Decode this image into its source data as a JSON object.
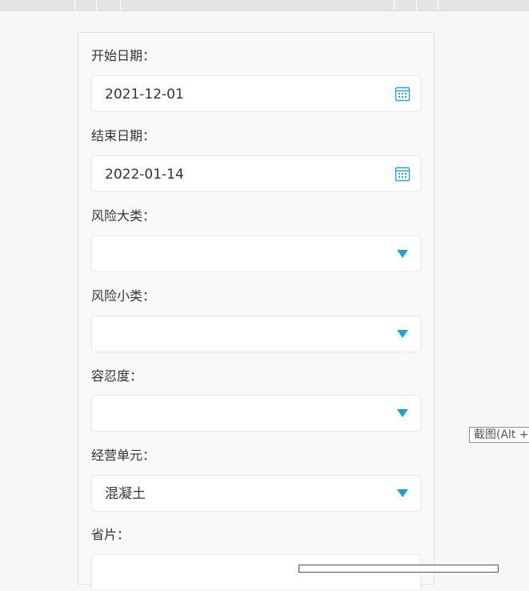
{
  "form": {
    "fields": [
      {
        "label": "开始日期：",
        "value": "2021-12-01",
        "type": "date",
        "icon": "calendar-icon"
      },
      {
        "label": "结束日期：",
        "value": "2022-01-14",
        "type": "date",
        "icon": "calendar-icon"
      },
      {
        "label": "风险大类：",
        "value": "",
        "type": "select",
        "icon": "chevron-down-icon"
      },
      {
        "label": "风险小类：",
        "value": "",
        "type": "select",
        "icon": "chevron-down-icon"
      },
      {
        "label": "容忍度：",
        "value": "",
        "type": "select",
        "icon": "chevron-down-icon"
      },
      {
        "label": "经营单元：",
        "value": "混凝土",
        "type": "select",
        "icon": "chevron-down-icon"
      },
      {
        "label": "省片：",
        "value": "",
        "type": "select",
        "icon": "chevron-down-icon"
      }
    ]
  },
  "tooltip": {
    "text": "截图(Alt + A)"
  },
  "colors": {
    "accent": "#1e9fd7",
    "background": "#f7f7f8",
    "panel": "#f9f9f9",
    "field_border": "#e8e8e8"
  }
}
